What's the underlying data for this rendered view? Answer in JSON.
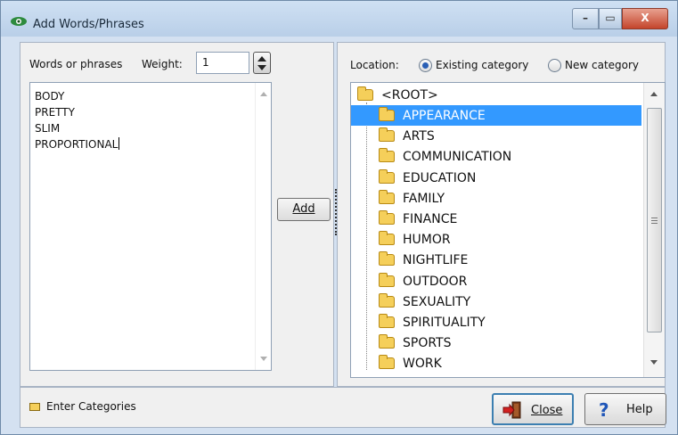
{
  "window": {
    "title": "Add Words/Phrases",
    "controls": {
      "minimize": "–",
      "maximize": "▭",
      "close": "X"
    }
  },
  "left": {
    "words_label": "Words or phrases",
    "weight_label": "Weight:",
    "weight_value": "1",
    "words": [
      "BODY",
      "PRETTY",
      "SLIM",
      "PROPORTIONAL"
    ]
  },
  "add_button": "Add",
  "right": {
    "location_label": "Location:",
    "radio_existing": "Existing category",
    "radio_new": "New category",
    "existing_selected": true,
    "root": "<ROOT>",
    "categories": [
      "APPEARANCE",
      "ARTS",
      "COMMUNICATION",
      "EDUCATION",
      "FAMILY",
      "FINANCE",
      "HUMOR",
      "NIGHTLIFE",
      "OUTDOOR",
      "SEXUALITY",
      "SPIRITUALITY",
      "SPORTS",
      "WORK"
    ],
    "selected_category": "APPEARANCE"
  },
  "bottom": {
    "enter_categories": "Enter Categories",
    "close_label": "Close",
    "help_label": "Help"
  },
  "colors": {
    "selection": "#3399ff",
    "folder": "#f5cf5a",
    "title_gradient": "#b9cfe8"
  }
}
